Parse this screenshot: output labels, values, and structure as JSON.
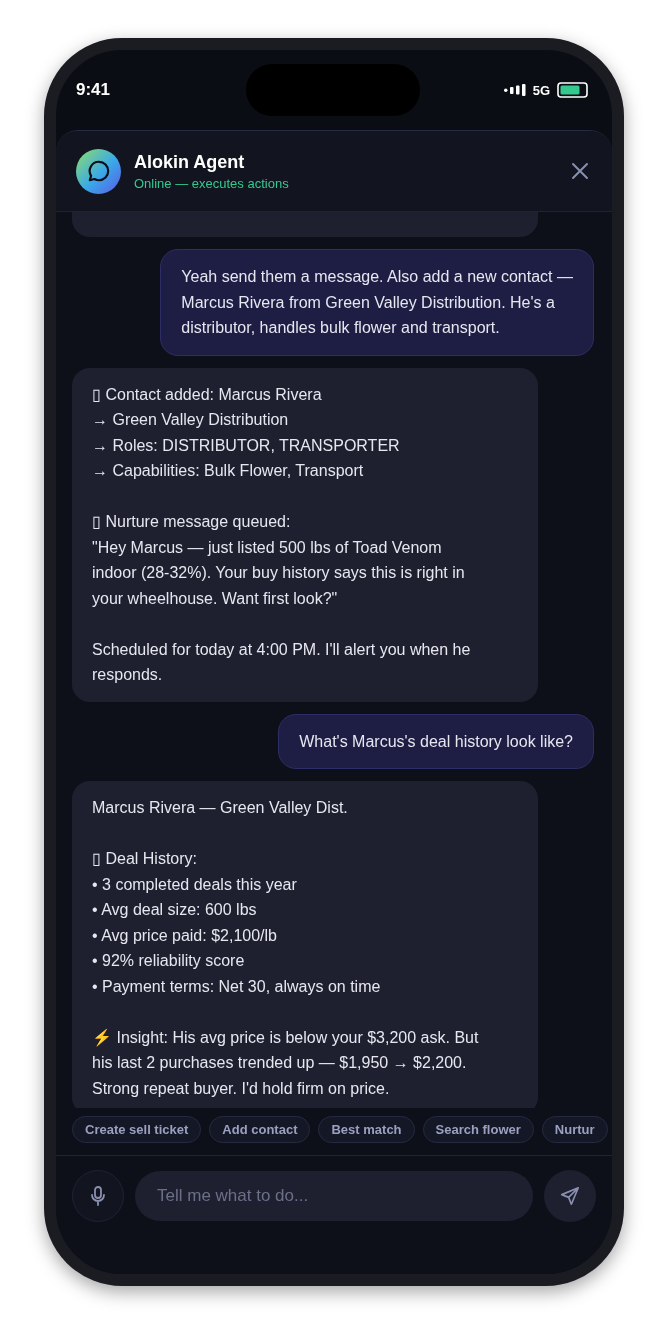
{
  "status_bar": {
    "time": "9:41",
    "network": "5G"
  },
  "header": {
    "title": "Alokin Agent",
    "subtitle": "Online — executes actions"
  },
  "messages": [
    {
      "kind": "clipped"
    },
    {
      "kind": "user",
      "text": "Yeah send them a message. Also add a new contact —\nMarcus Rivera from Green Valley Distribution. He's a\ndistributor, handles bulk flower and transport."
    },
    {
      "kind": "agent",
      "text": "▯ Contact added: Marcus Rivera\n→ Green Valley Distribution\n→ Roles: DISTRIBUTOR, TRANSPORTER\n→ Capabilities: Bulk Flower, Transport\n\n▯ Nurture message queued:\n\"Hey Marcus — just listed 500 lbs of Toad Venom\nindoor (28-32%). Your buy history says this is right in\nyour wheelhouse. Want first look?\"\n\nScheduled for today at 4:00 PM. I'll alert you when he\nresponds."
    },
    {
      "kind": "user",
      "text": "What's Marcus's deal history look like?"
    },
    {
      "kind": "agent",
      "text": "Marcus Rivera — Green Valley Dist.\n\n▯ Deal History:\n• 3 completed deals this year\n• Avg deal size: 600 lbs\n• Avg price paid: $2,100/lb\n• 92% reliability score\n• Payment terms: Net 30, always on time\n\n⚡ Insight: His avg price is below your $3,200 ask. But\nhis last 2 purchases trended up — $1,950 → $2,200.\nStrong repeat buyer. I'd hold firm on price."
    }
  ],
  "suggestions": [
    "Create sell ticket",
    "Add contact",
    "Best match",
    "Search flower",
    "Nurtur"
  ],
  "composer": {
    "placeholder": "Tell me what to do..."
  }
}
